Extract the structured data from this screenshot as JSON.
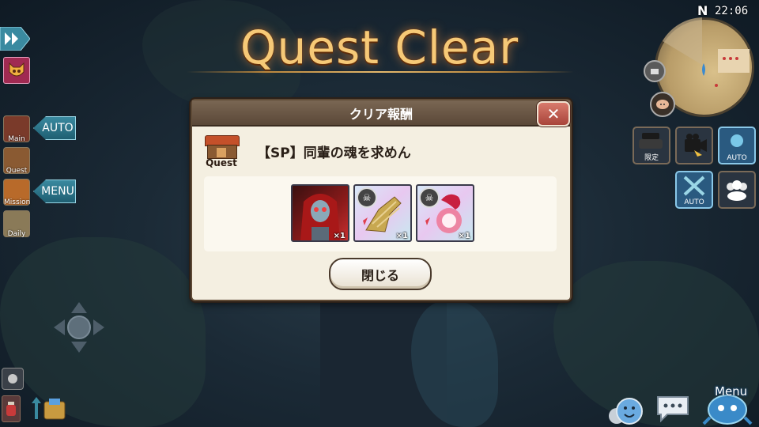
{
  "screen": {
    "title": "Quest Clear",
    "clock": "22:06",
    "compass": "N"
  },
  "dialog": {
    "header": "クリア報酬",
    "close_symbol": "✕",
    "quest_icon_label": "Quest",
    "quest_name": "【SP】同輩の魂を求めん",
    "rewards": [
      {
        "name": "red-hooded-undead-card",
        "qty": "×1"
      },
      {
        "name": "golden-dragon-bone-card",
        "qty": "×1"
      },
      {
        "name": "flame-skull-card",
        "qty": "×1"
      }
    ],
    "close_button": "閉じる"
  },
  "left_menu": {
    "auto_label": "AUTO",
    "menu_label": "MENU",
    "items": [
      {
        "label": "Main"
      },
      {
        "label": "Quest"
      },
      {
        "label": "Mission"
      },
      {
        "label": "Daily"
      }
    ]
  },
  "right_menu": {
    "limited_label": "限定",
    "auto_label": "AUTO",
    "auto_label_2": "AUTO",
    "menu_label": "Menu"
  },
  "colors": {
    "title": "#f6c977",
    "dialog_bg": "#f4efe1",
    "dialog_header": "#6a5646",
    "close_button": "#b8524a",
    "accent_blue": "#3a8aa0"
  }
}
